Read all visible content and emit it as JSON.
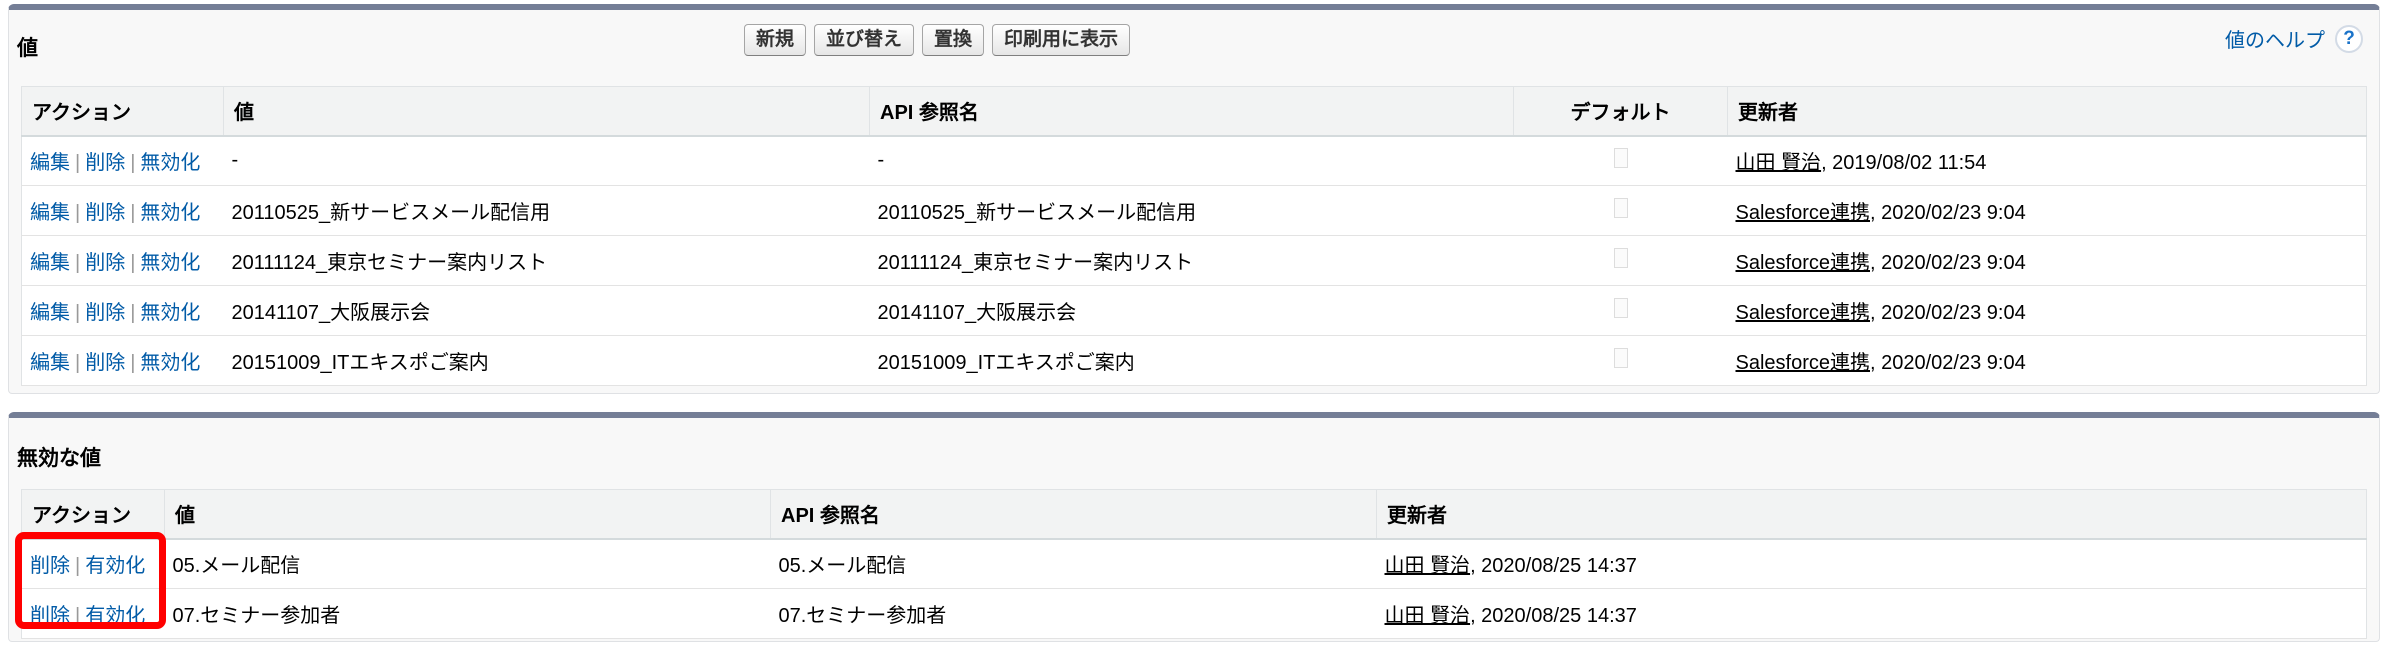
{
  "active_section": {
    "title": "値",
    "buttons": [
      "新規",
      "並び替え",
      "置換",
      "印刷用に表示"
    ],
    "help_link": "値のヘルプ",
    "help_icon": "question-icon",
    "columns": [
      "アクション",
      "値",
      "API 参照名",
      "デフォルト",
      "更新者"
    ],
    "actions": [
      "編集",
      "削除",
      "無効化"
    ],
    "rows": [
      {
        "value": "-",
        "api": "-",
        "default": false,
        "user": "山田 賢治",
        "date": ", 2019/08/02 11:54"
      },
      {
        "value": "20110525_新サービスメール配信用",
        "api": "20110525_新サービスメール配信用",
        "default": false,
        "user": "Salesforce連携",
        "date": ", 2020/02/23 9:04"
      },
      {
        "value": "20111124_東京セミナー案内リスト",
        "api": "20111124_東京セミナー案内リスト",
        "default": false,
        "user": "Salesforce連携",
        "date": ", 2020/02/23 9:04"
      },
      {
        "value": "20141107_大阪展示会",
        "api": "20141107_大阪展示会",
        "default": false,
        "user": "Salesforce連携",
        "date": ", 2020/02/23 9:04"
      },
      {
        "value": "20151009_ITエキスポご案内",
        "api": "20151009_ITエキスポご案内",
        "default": false,
        "user": "Salesforce連携",
        "date": ", 2020/02/23 9:04"
      }
    ]
  },
  "inactive_section": {
    "title": "無効な値",
    "columns": [
      "アクション",
      "値",
      "API 参照名",
      "更新者"
    ],
    "actions": [
      "削除",
      "有効化"
    ],
    "rows": [
      {
        "value": "05.メール配信",
        "api": "05.メール配信",
        "user": "山田 賢治",
        "date": ", 2020/08/25 14:37"
      },
      {
        "value": "07.セミナー参加者",
        "api": "07.セミナー参加者",
        "user": "山田 賢治",
        "date": ", 2020/08/25 14:37"
      }
    ]
  },
  "highlight_color": "#ff0000",
  "link_color": "#015ba7"
}
